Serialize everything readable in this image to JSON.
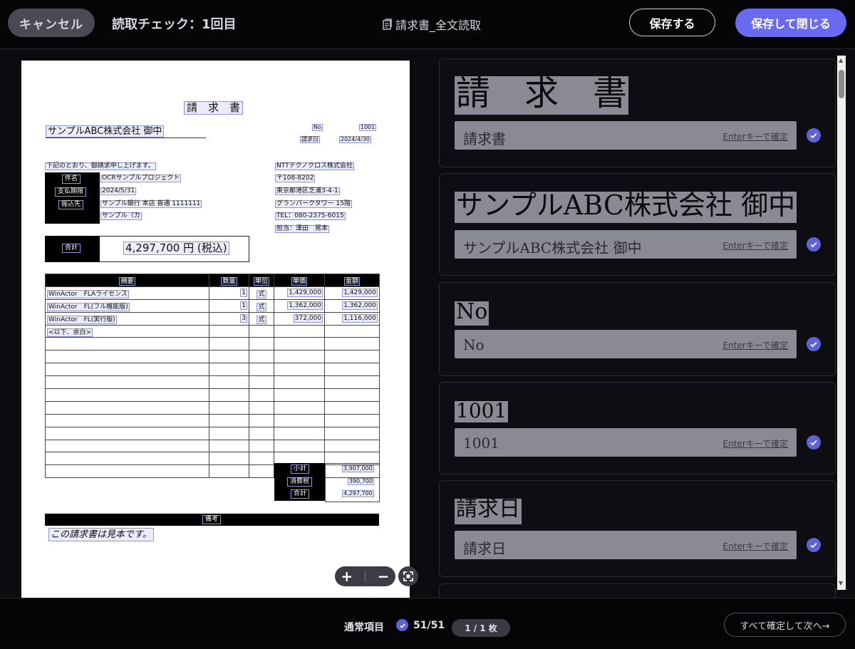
{
  "header": {
    "cancel_label": "キャンセル",
    "title": "読取チェック：1回目",
    "doc_title": "請求書_全文読取",
    "save_label": "保存する",
    "save_close_label": "保存して閉じる"
  },
  "document": {
    "heading": "請　求　書",
    "recipient": "サンプルABC株式会社 御中",
    "no_label": "No",
    "no_value": "1001",
    "date_label": "請求日",
    "date_value": "2024/4/30",
    "intro": "下記のとおり、御請求申し上げます。",
    "info_labels": [
      "件名",
      "支払期限",
      "振込先"
    ],
    "info_values": [
      "OCRサンプルプロジェクト",
      "2024/5/31",
      "サンプル銀行 本店 普通 1111111",
      "サンプル（カ"
    ],
    "issuer": [
      "NTTテクノクロス株式会社",
      "〒108-8202",
      "東京都港区芝浦3-4-1",
      "グランパークタワー 15階",
      "TEL：080-2375-6015",
      "担当：澤田　晃本"
    ],
    "total_label": "合計",
    "total_value": "4,297,700 円 (税込)",
    "table_headers": [
      "摘要",
      "数量",
      "単位",
      "単価",
      "金額"
    ],
    "rows": [
      {
        "desc": "WinActor　FLAライセンス",
        "qty": "1",
        "unit": "式",
        "price": "1,429,000",
        "amount": "1,429,000"
      },
      {
        "desc": "WinActor　FL(フル機能版)",
        "qty": "1",
        "unit": "式",
        "price": "1,362,000",
        "amount": "1,362,000"
      },
      {
        "desc": "WinActor　FL(実行版)",
        "qty": "3",
        "unit": "式",
        "price": "372,000",
        "amount": "1,116,000"
      },
      {
        "desc": "<以下、余白>",
        "qty": "",
        "unit": "",
        "price": "",
        "amount": ""
      }
    ],
    "summary_labels": [
      "小計",
      "消費税",
      "合計"
    ],
    "summary_values": [
      "3,907,000",
      "390,700",
      "4,297,700"
    ],
    "remarks_label": "備考",
    "remarks": "この請求書は見本です。"
  },
  "cards": [
    {
      "crop": "請　求　書",
      "value": "請求書",
      "hint": "Enterキーで確定"
    },
    {
      "crop": "サンプルABC株式会社 御中",
      "value": "サンプルABC株式会社 御中",
      "hint": "Enterキーで確定"
    },
    {
      "crop": "No",
      "value": "No",
      "hint": "Enterキーで確定"
    },
    {
      "crop": "1001",
      "value": "1001",
      "hint": "Enterキーで確定"
    },
    {
      "crop": "請求日",
      "value": "請求日",
      "hint": "Enterキーで確定"
    }
  ],
  "footer": {
    "label": "通常項目",
    "count": "51/51",
    "page": "1 / 1 枚",
    "next_label": "すべて確定して次へ→"
  },
  "colors": {
    "accent": "#6a6af0",
    "check": "#5d63d6",
    "highlight": "#8e95dc"
  },
  "icons": [
    "document-icon",
    "check-icon",
    "zoom-in-icon",
    "zoom-out-icon",
    "fit-screen-icon"
  ]
}
